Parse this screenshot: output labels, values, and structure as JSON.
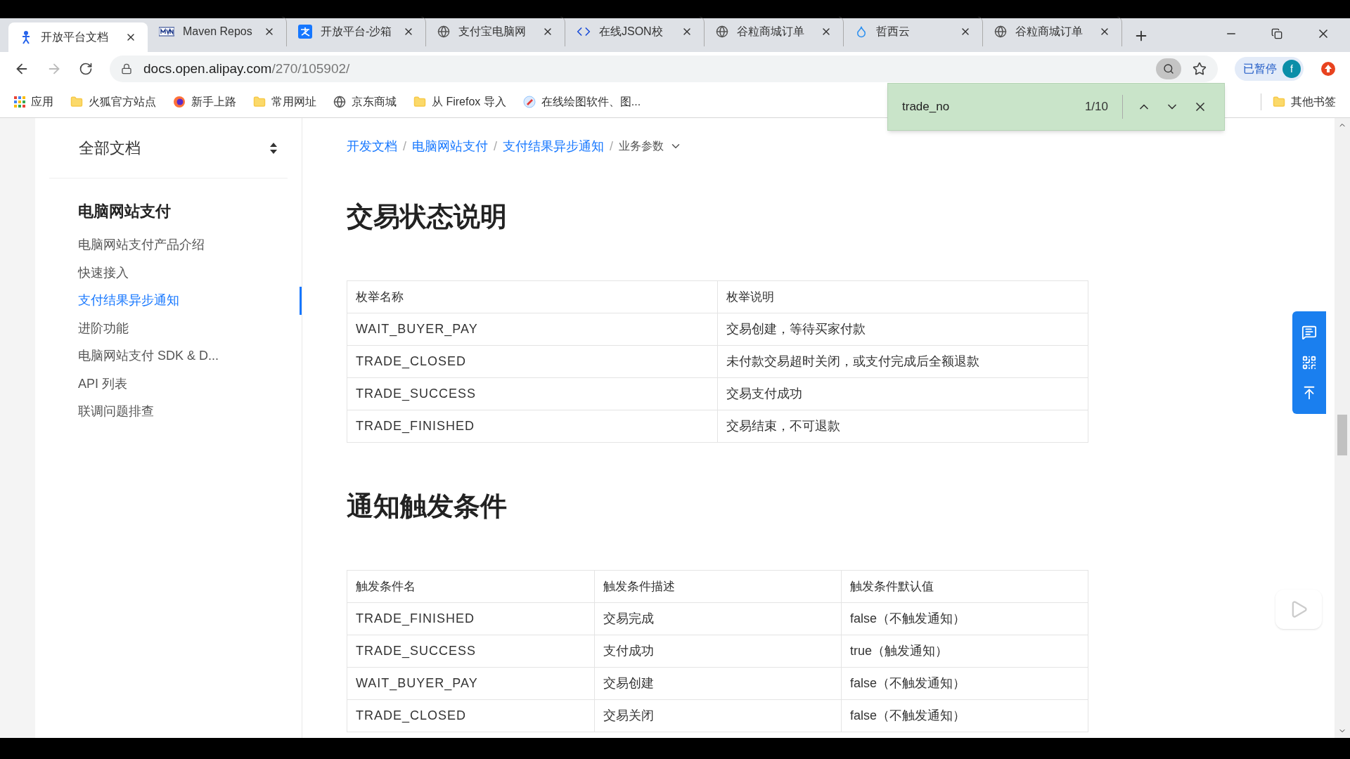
{
  "tabs": [
    {
      "title": "开放平台文档",
      "kind": "figure",
      "selected": true
    },
    {
      "title": "Maven Repos",
      "kind": "mvn",
      "selected": false
    },
    {
      "title": "开放平台-沙箱",
      "kind": "pay",
      "selected": false
    },
    {
      "title": "支付宝电脑网",
      "kind": "globe",
      "selected": false
    },
    {
      "title": "在线JSON校",
      "kind": "code",
      "selected": false
    },
    {
      "title": "谷粒商城订单",
      "kind": "globe",
      "selected": false
    },
    {
      "title": "哲西云",
      "kind": "drop",
      "selected": false
    },
    {
      "title": "谷粒商城订单",
      "kind": "globe",
      "selected": false
    }
  ],
  "address": {
    "host": "docs.open.alipay.com",
    "path": "/270/105902/"
  },
  "profile": {
    "status": "已暂停",
    "initial": "f"
  },
  "bookmarks": [
    {
      "label": "应用",
      "kind": "apps"
    },
    {
      "label": "火狐官方站点",
      "kind": "folder"
    },
    {
      "label": "新手上路",
      "kind": "firefox"
    },
    {
      "label": "常用网址",
      "kind": "folder"
    },
    {
      "label": "京东商城",
      "kind": "globe"
    },
    {
      "label": "从 Firefox 导入",
      "kind": "folder"
    },
    {
      "label": "在线绘图软件、图...",
      "kind": "draw"
    }
  ],
  "other_bookmarks": "其他书签",
  "find_bar": {
    "query": "trade_no",
    "count": "1/10"
  },
  "sidebar": {
    "header": "全部文档",
    "section": "电脑网站支付",
    "items": [
      {
        "label": "电脑网站支付产品介绍",
        "selected": false
      },
      {
        "label": "快速接入",
        "selected": false
      },
      {
        "label": "支付结果异步通知",
        "selected": true
      },
      {
        "label": "进阶功能",
        "selected": false
      },
      {
        "label": "电脑网站支付 SDK & D...",
        "selected": false
      },
      {
        "label": "API 列表",
        "selected": false
      },
      {
        "label": "联调问题排查",
        "selected": false
      }
    ]
  },
  "breadcrumb": {
    "links": [
      "开发文档",
      "电脑网站支付",
      "支付结果异步通知"
    ],
    "separator": "/",
    "current": "业务参数"
  },
  "sections": [
    {
      "heading": "交易状态说明",
      "columns": [
        "枚举名称",
        "枚举说明"
      ],
      "rows": [
        [
          "WAIT_BUYER_PAY",
          "交易创建，等待买家付款"
        ],
        [
          "TRADE_CLOSED",
          "未付款交易超时关闭，或支付完成后全额退款"
        ],
        [
          "TRADE_SUCCESS",
          "交易支付成功"
        ],
        [
          "TRADE_FINISHED",
          "交易结束，不可退款"
        ]
      ]
    },
    {
      "heading": "通知触发条件",
      "columns": [
        "触发条件名",
        "触发条件描述",
        "触发条件默认值"
      ],
      "rows": [
        [
          "TRADE_FINISHED",
          "交易完成",
          "false（不触发通知）"
        ],
        [
          "TRADE_SUCCESS",
          "支付成功",
          "true（触发通知）"
        ],
        [
          "WAIT_BUYER_PAY",
          "交易创建",
          "false（不触发通知）"
        ],
        [
          "TRADE_CLOSED",
          "交易关闭",
          "false（不触发通知）"
        ]
      ]
    }
  ]
}
